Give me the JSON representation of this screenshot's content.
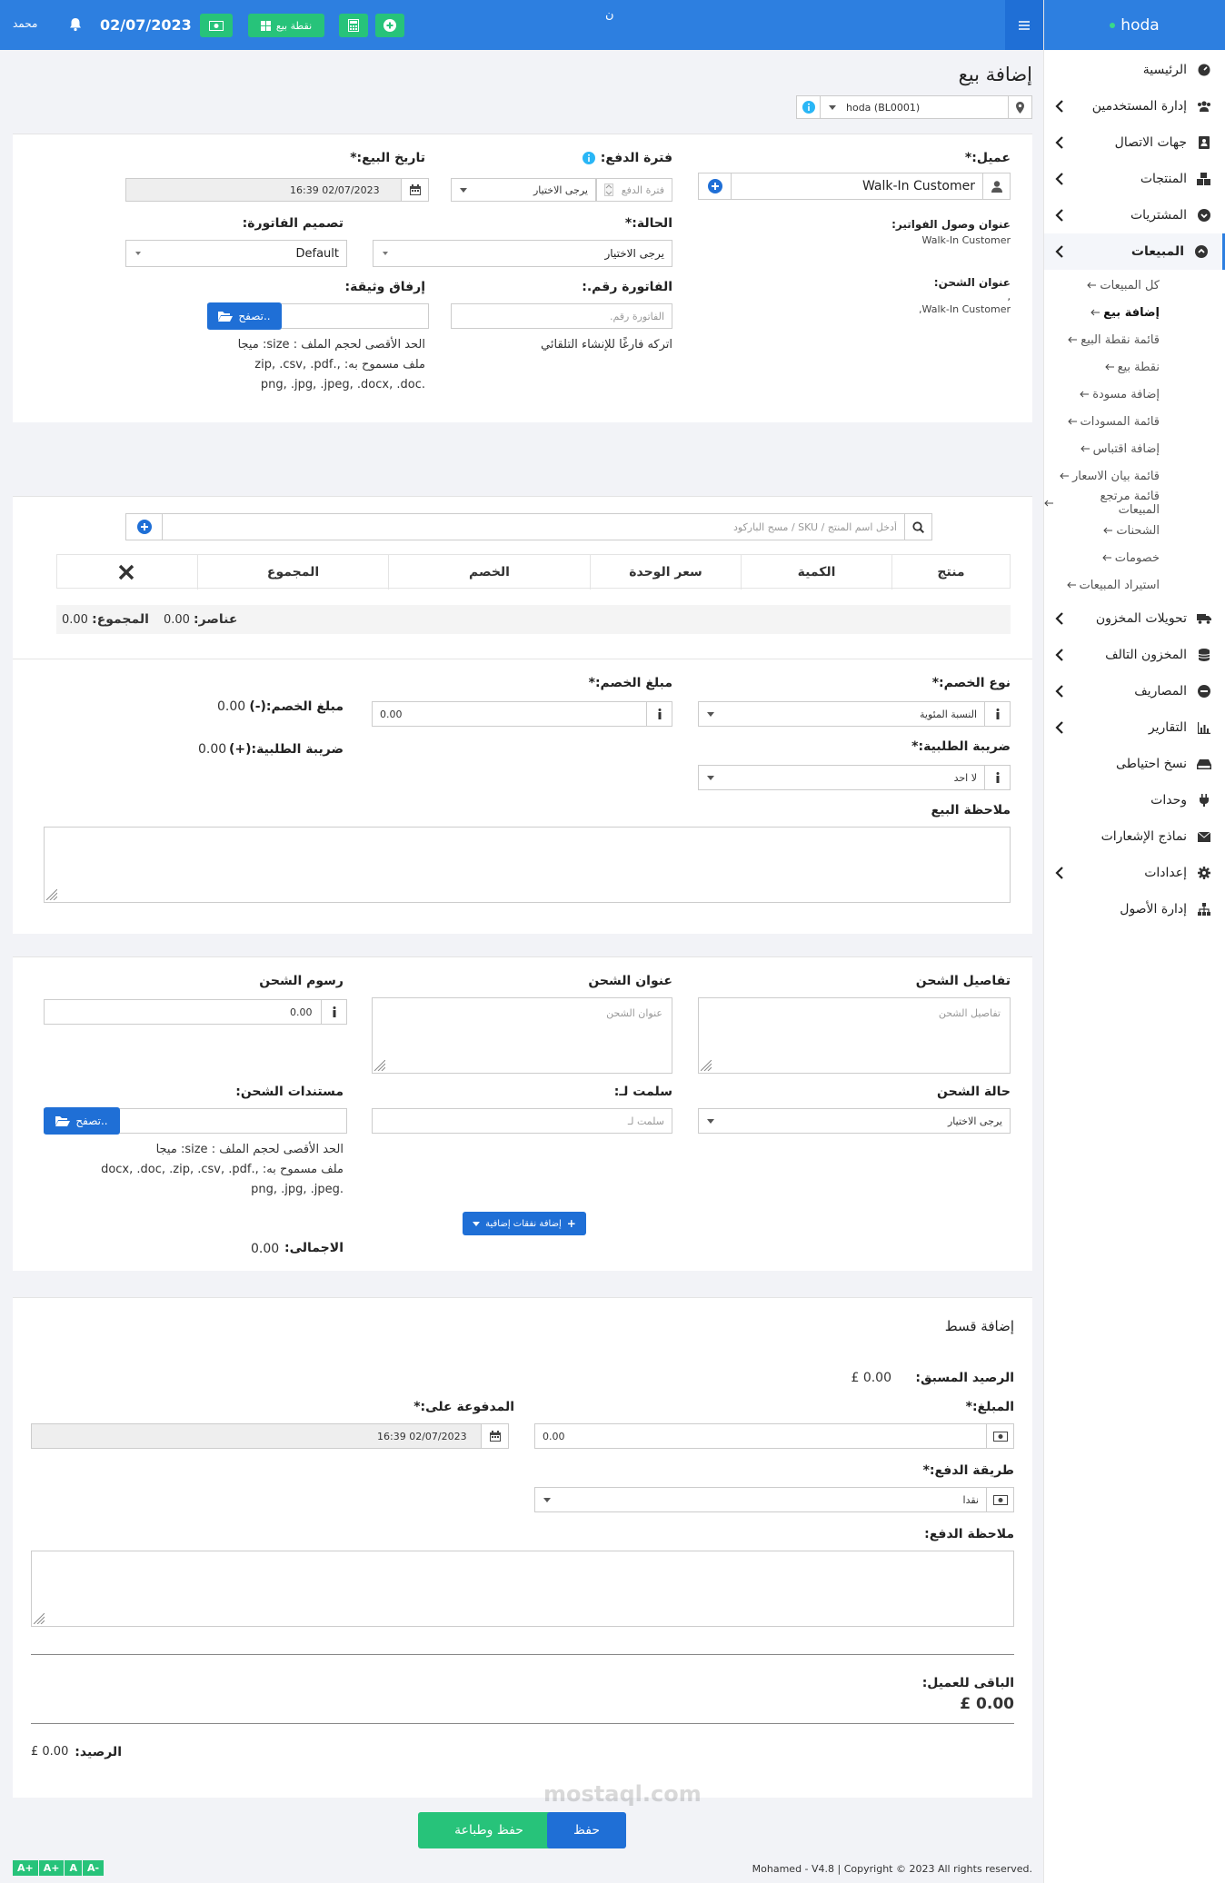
{
  "brand": {
    "name": "hoda"
  },
  "topbar": {
    "user": "محمد",
    "date": "02/07/2023",
    "pos_label": "نقطة بيع",
    "center_glyph": "ن"
  },
  "sidebar": {
    "items": [
      {
        "label": "الرئيسية",
        "icon": "dashboard-icon",
        "chevron": false
      },
      {
        "label": "إدارة المستخدمين",
        "icon": "users-icon",
        "chevron": true
      },
      {
        "label": "جهات الاتصال",
        "icon": "contacts-icon",
        "chevron": true
      },
      {
        "label": "المنتجات",
        "icon": "cubes-icon",
        "chevron": true
      },
      {
        "label": "المشتريات",
        "icon": "arrow-circle-down-icon",
        "chevron": true
      },
      {
        "label": "المبيعات",
        "icon": "arrow-circle-up-icon",
        "chevron": true
      }
    ],
    "sales_sub": [
      "كل المبيعات",
      "إضافة بيع",
      "قائمة نقطة البيع",
      "نقطة بيع",
      "إضافة مسودة",
      "قائمة المسودات",
      "إضافة اقتباس",
      "قائمة بيان الاسعار",
      "قائمة مرتجع المبيعات",
      "الشحنات",
      "خصومات",
      "استيراد المبيعات"
    ],
    "items2": [
      {
        "label": "تحويلات المخزون",
        "icon": "truck-icon",
        "chevron": true
      },
      {
        "label": "المخزون التالف",
        "icon": "database-icon",
        "chevron": true
      },
      {
        "label": "المصاريف",
        "icon": "minus-circle-icon",
        "chevron": true
      },
      {
        "label": "التقارير",
        "icon": "bar-chart-icon",
        "chevron": true
      },
      {
        "label": "نسخ احتياطى",
        "icon": "hdd-icon",
        "chevron": false
      },
      {
        "label": "وحدات",
        "icon": "plug-icon",
        "chevron": false
      },
      {
        "label": "نماذج الإشعارات",
        "icon": "envelope-icon",
        "chevron": false
      },
      {
        "label": "إعدادات",
        "icon": "cog-icon",
        "chevron": true
      },
      {
        "label": "إدارة الأصول",
        "icon": "sitemap-icon",
        "chevron": false
      }
    ]
  },
  "page": {
    "title": "إضافة بيع",
    "location": "hoda (BL0001)"
  },
  "form1": {
    "customer_label": "عميل:*",
    "customer_value": "Walk-In Customer",
    "billing_label": "عنوان وصول الفواتير:",
    "billing_value": "Walk-In Customer",
    "shipping_label": "عنوان الشحن:",
    "shipping_value": ",",
    "shipping_value2": "Walk-In Customer,",
    "pay_term_label": "فترة الدفع:",
    "pay_term_placeholder": "فترة الدفع",
    "pay_term_select": "يرجى الاختيار",
    "sale_date_label": "تاريخ البيع:*",
    "sale_date_value": "02/07/2023 16:39",
    "status_label": "الحالة:*",
    "status_value": "يرجى الاختيار",
    "invoice_layout_label": "تصميم الفاتورة:",
    "invoice_layout_value": "Default",
    "invoice_no_label": "الفاتورة رقم.:",
    "invoice_no_placeholder": "الفاتورة رقم.",
    "invoice_no_help": "اتركه فارغًا للإنشاء التلقائي",
    "attach_label": "إرفاق وثيقة:",
    "browse": "تصفح..",
    "attach_help1": "الحد الأقصى لحجم الملف : size: ميجا",
    "attach_help2": "ملف مسموح به: ,.zip, .csv, .pdf",
    "attach_help3": ".png, .jpg, .jpeg, .docx, .doc"
  },
  "products": {
    "search_placeholder": "أدخل اسم المنتج / SKU / مسح الباركود",
    "headers": [
      "منتج",
      "الكمية",
      "سعر الوحدة",
      "الخصم",
      "المجموع"
    ],
    "items_label": "عناصر:",
    "items_value": "0.00",
    "total_label": "المجموع:",
    "total_value": "0.00"
  },
  "discount": {
    "type_label": "نوع الخصم:*",
    "type_value": "النسبة المئوية",
    "amount_label": "مبلغ الخصم:*",
    "amount_value": "0.00",
    "discount_total_label": "مبلغ الخصم:(-)",
    "discount_total_value": "0.00",
    "tax_label": "ضريبة الطلبية:*",
    "tax_value": "لا احد",
    "tax_total_label": "ضريبة الطلبية:(+)",
    "tax_total_value": "0.00",
    "note_label": "ملاحظة البيع"
  },
  "shipping": {
    "details_label": "تفاصيل الشحن",
    "details_placeholder": "تفاصيل الشحن",
    "address_label": "عنوان الشحن",
    "address_placeholder": "عنوان الشحن",
    "charges_label": "رسوم الشحن",
    "charges_value": "0.00",
    "status_label": "حالة الشحن",
    "status_value": "يرجى الاختيار",
    "delivered_label": "سلمت لـ:",
    "delivered_placeholder": "سلمت لـ",
    "docs_label": "مستندات الشحن:",
    "browse": "تصفح..",
    "docs_help1": "الحد الأقصى لحجم الملف : size: ميجا",
    "docs_help2": "ملف مسموح به: ,.docx, .doc, .zip, .csv, .pdf",
    "docs_help3": ".png, .jpg, .jpeg",
    "add_expenses": "إضافة نفقات إضافية",
    "total_label": "الاجمالى:",
    "total_value": "0.00"
  },
  "payment": {
    "title": "إضافة قسط",
    "advance_label": "الرصيد المسبق:",
    "advance_value": "£ 0.00",
    "amount_label": "المبلغ:*",
    "amount_value": "0.00",
    "paid_on_label": "المدفوعة على:*",
    "paid_on_value": "02/07/2023 16:39",
    "method_label": "طريقة الدفع:*",
    "method_value": "نقدا",
    "note_label": "ملاحظة الدفع:",
    "change_label": "الباقى للعميل:",
    "change_value": "£ 0.00",
    "balance_label": "الرصيد:",
    "balance_value": "£ 0.00"
  },
  "actions": {
    "save_print": "حفظ وطباعة",
    "save": "حفظ"
  },
  "footer": {
    "copyright": "Mohamed - V4.8 | Copyright © 2023 All rights reserved.",
    "font_btn1": "A+",
    "font_btn2": "A+",
    "font_btn3": "A",
    "font_btn4": "A-"
  },
  "watermark": "mostaql.com",
  "colors": {
    "brand_blue": "#2d7fe0",
    "green": "#27c37a",
    "button_blue": "#1f6fd6",
    "info": "#29b6f6"
  }
}
